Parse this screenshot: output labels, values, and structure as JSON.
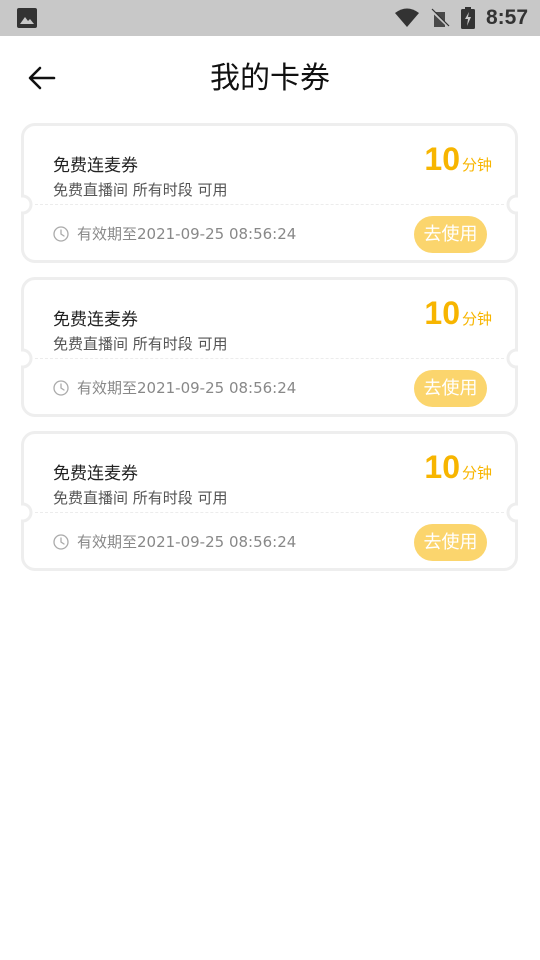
{
  "status_bar": {
    "time": "8:57"
  },
  "header": {
    "title": "我的卡券"
  },
  "coupons": [
    {
      "name": "免费连麦券",
      "desc": "免费直播间 所有时段 可用",
      "value": "10",
      "unit": "分钟",
      "validity": "有效期至2021-09-25 08:56:24",
      "button": "去使用"
    },
    {
      "name": "免费连麦券",
      "desc": "免费直播间 所有时段 可用",
      "value": "10",
      "unit": "分钟",
      "validity": "有效期至2021-09-25 08:56:24",
      "button": "去使用"
    },
    {
      "name": "免费连麦券",
      "desc": "免费直播间 所有时段 可用",
      "value": "10",
      "unit": "分钟",
      "validity": "有效期至2021-09-25 08:56:24",
      "button": "去使用"
    }
  ],
  "colors": {
    "accent": "#f7b500",
    "button_bg": "#fbd56d",
    "status_bar": "#c8c8c8"
  }
}
